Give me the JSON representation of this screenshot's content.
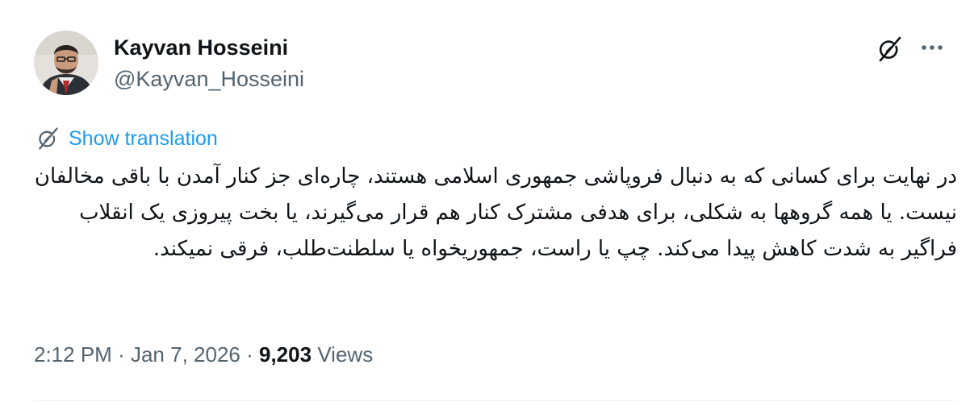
{
  "author": {
    "name": "Kayvan Hosseini",
    "handle": "@Kayvan_Hosseini"
  },
  "icons": {
    "grok": "grok-icon",
    "more": "more-options-icon",
    "translate": "translate-icon"
  },
  "translation": {
    "link_label": "Show translation"
  },
  "tweet": {
    "text": "در نهایت برای کسانی که به دنبال فروپاشی جمهوری اسلامی هستند، چاره‌ای جز کنار آمدن با باقی مخالفان نیست. یا همه گروهها به شکلی، برای هدفی مشترک کنار هم قرار می‌گیرند، یا بخت پیروزی یک انقلاب فراگیر به شدت کاهش پیدا می‌کند. چپ یا راست، جمهوریخواه یا سلطنت‌طلب، فرقی نمیکند."
  },
  "meta": {
    "time": "2:12 PM",
    "separator": "·",
    "date": "Jan 7, 2026",
    "views_count": "9,203",
    "views_label": "Views"
  },
  "colors": {
    "link": "#1d9bf0",
    "secondary_text": "#536471",
    "primary_text": "#0f1419",
    "divider": "#eff3f4"
  }
}
